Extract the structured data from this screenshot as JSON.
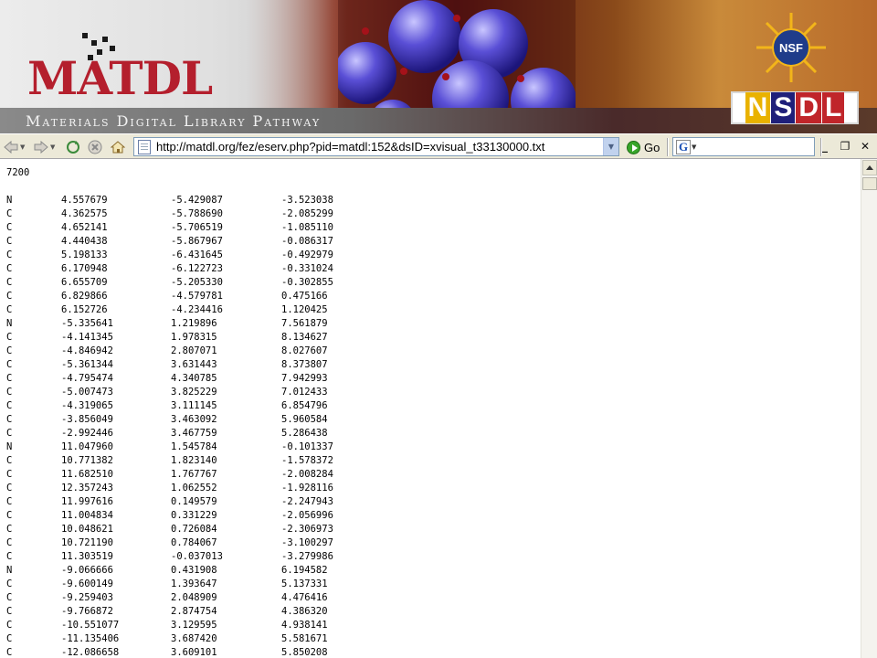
{
  "banner": {
    "logo_text": "MATDL",
    "tagline": "Materials Digital Library Pathway",
    "nsf_text": "NSF",
    "nsdl_letters": [
      "N",
      "S",
      "D",
      "L"
    ]
  },
  "toolbar": {
    "address_url": "http://matdl.org/fez/eserv.php?pid=matdl:152&dsID=xvisual_t33130000.txt",
    "go_label": "Go",
    "search_logo_letter": "G",
    "icons": [
      "back-arrow-icon",
      "forward-arrow-icon",
      "refresh-icon",
      "stop-icon",
      "home-icon",
      "page-icon",
      "go-icon",
      "google-icon",
      "minimize-icon",
      "restore-icon",
      "close-icon"
    ]
  },
  "content": {
    "atom_count": "7200",
    "rows": [
      [
        "N",
        "4.557679",
        "-5.429087",
        "-3.523038"
      ],
      [
        "C",
        "4.362575",
        "-5.788690",
        "-2.085299"
      ],
      [
        "C",
        "4.652141",
        "-5.706519",
        "-1.085110"
      ],
      [
        "C",
        "4.440438",
        "-5.867967",
        "-0.086317"
      ],
      [
        "C",
        "5.198133",
        "-6.431645",
        "-0.492979"
      ],
      [
        "C",
        "6.170948",
        "-6.122723",
        "-0.331024"
      ],
      [
        "C",
        "6.655709",
        "-5.205330",
        "-0.302855"
      ],
      [
        "C",
        "6.829866",
        "-4.579781",
        "0.475166"
      ],
      [
        "C",
        "6.152726",
        "-4.234416",
        "1.120425"
      ],
      [
        "N",
        "-5.335641",
        "1.219896",
        "7.561879"
      ],
      [
        "C",
        "-4.141345",
        "1.978315",
        "8.134627"
      ],
      [
        "C",
        "-4.846942",
        "2.807071",
        "8.027607"
      ],
      [
        "C",
        "-5.361344",
        "3.631443",
        "8.373807"
      ],
      [
        "C",
        "-4.795474",
        "4.340785",
        "7.942993"
      ],
      [
        "C",
        "-5.007473",
        "3.825229",
        "7.012433"
      ],
      [
        "C",
        "-4.319065",
        "3.111145",
        "6.854796"
      ],
      [
        "C",
        "-3.856049",
        "3.463092",
        "5.960584"
      ],
      [
        "C",
        "-2.992446",
        "3.467759",
        "5.286438"
      ],
      [
        "N",
        "11.047960",
        "1.545784",
        "-0.101337"
      ],
      [
        "C",
        "10.771382",
        "1.823140",
        "-1.578372"
      ],
      [
        "C",
        "11.682510",
        "1.767767",
        "-2.008284"
      ],
      [
        "C",
        "12.357243",
        "1.062552",
        "-1.928116"
      ],
      [
        "C",
        "11.997616",
        "0.149579",
        "-2.247943"
      ],
      [
        "C",
        "11.004834",
        "0.331229",
        "-2.056996"
      ],
      [
        "C",
        "10.048621",
        "0.726084",
        "-2.306973"
      ],
      [
        "C",
        "10.721190",
        "0.784067",
        "-3.100297"
      ],
      [
        "C",
        "11.303519",
        "-0.037013",
        "-3.279986"
      ],
      [
        "N",
        "-9.066666",
        "0.431908",
        "6.194582"
      ],
      [
        "C",
        "-9.600149",
        "1.393647",
        "5.137331"
      ],
      [
        "C",
        "-9.259403",
        "2.048909",
        "4.476416"
      ],
      [
        "C",
        "-9.766872",
        "2.874754",
        "4.386320"
      ],
      [
        "C",
        "-10.551077",
        "3.129595",
        "4.938141"
      ],
      [
        "C",
        "-11.135406",
        "3.687420",
        "5.581671"
      ],
      [
        "C",
        "-12.086658",
        "3.609101",
        "5.850208"
      ]
    ]
  }
}
